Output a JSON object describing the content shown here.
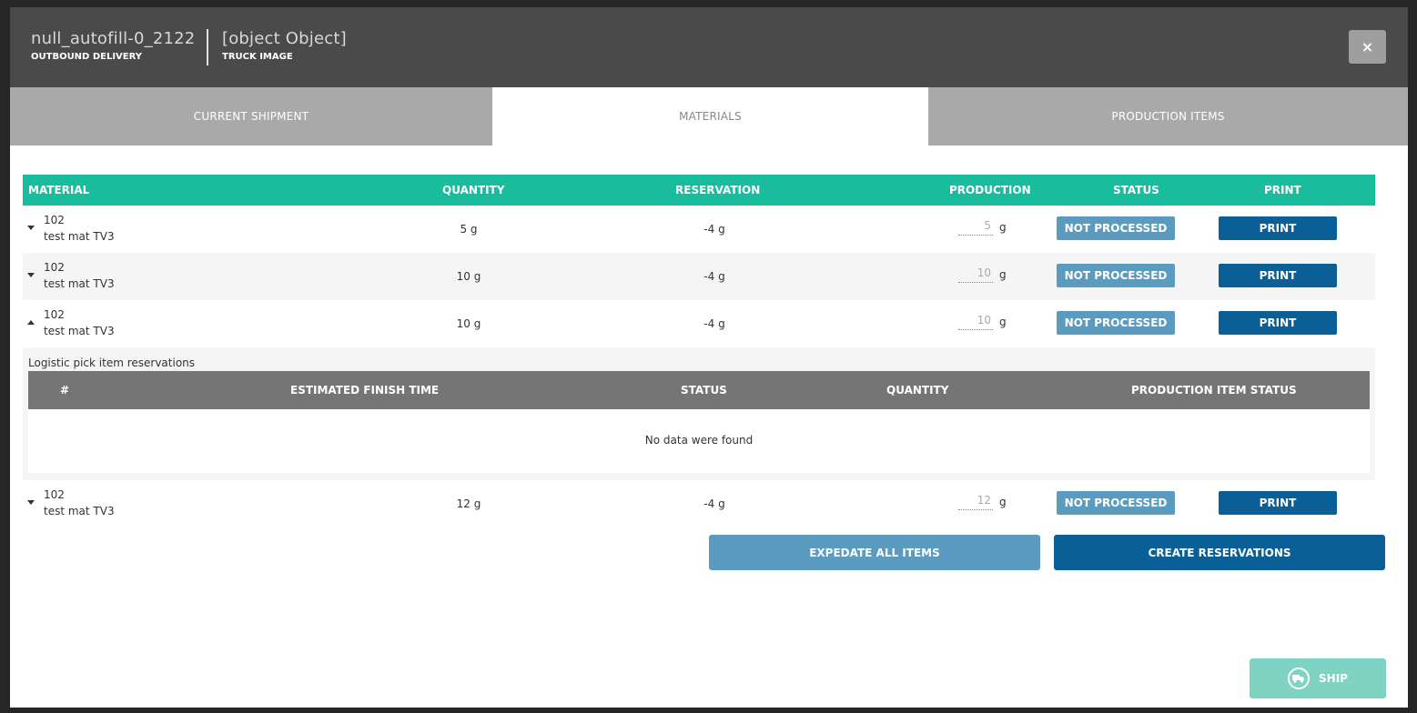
{
  "header": {
    "title": "null_autofill-0_2122",
    "subtitle": "OUTBOUND DELIVERY",
    "secondary_title": "[object Object]",
    "secondary_subtitle": "TRUCK IMAGE",
    "close_label": "×"
  },
  "tabs": [
    {
      "label": "CURRENT SHIPMENT",
      "active": false
    },
    {
      "label": "MATERIALS",
      "active": true
    },
    {
      "label": "PRODUCTION ITEMS",
      "active": false
    }
  ],
  "table": {
    "headers": {
      "material": "MATERIAL",
      "quantity": "QUANTITY",
      "reservation": "RESERVATION",
      "production": "PRODUCTION",
      "status": "STATUS",
      "print": "PRINT"
    },
    "rows": [
      {
        "number": "102",
        "name": "test mat TV3",
        "quantity": "5 g",
        "reservation": "-4 g",
        "production": "5",
        "unit": "g",
        "status": "NOT PROCESSED",
        "print": "PRINT",
        "expanded": false
      },
      {
        "number": "102",
        "name": "test mat TV3",
        "quantity": "10 g",
        "reservation": "-4 g",
        "production": "10",
        "unit": "g",
        "status": "NOT PROCESSED",
        "print": "PRINT",
        "expanded": false
      },
      {
        "number": "102",
        "name": "test mat TV3",
        "quantity": "10 g",
        "reservation": "-4 g",
        "production": "10",
        "unit": "g",
        "status": "NOT PROCESSED",
        "print": "PRINT",
        "expanded": true
      },
      {
        "number": "102",
        "name": "test mat TV3",
        "quantity": "12 g",
        "reservation": "-4 g",
        "production": "12",
        "unit": "g",
        "status": "NOT PROCESSED",
        "print": "PRINT",
        "expanded": false
      }
    ]
  },
  "reservations": {
    "title": "Logistic pick item reservations",
    "headers": {
      "number": "#",
      "finish_time": "ESTIMATED FINISH TIME",
      "status": "STATUS",
      "quantity": "QUANTITY",
      "production_status": "PRODUCTION ITEM STATUS"
    },
    "empty_message": "No data were found"
  },
  "actions": {
    "expedite": "EXPEDATE ALL ITEMS",
    "create": "CREATE RESERVATIONS",
    "ship": "SHIP"
  },
  "colors": {
    "table_header": "#19bc9c",
    "status_button": "#5b9bc0",
    "print_button": "#0a6096",
    "ship_button": "#7fd3c3",
    "modal_header": "#4a4a4a"
  },
  "icons": {
    "close": "close-icon",
    "ship": "truck-icon",
    "expand": "caret-down-icon",
    "collapse": "caret-up-icon"
  }
}
